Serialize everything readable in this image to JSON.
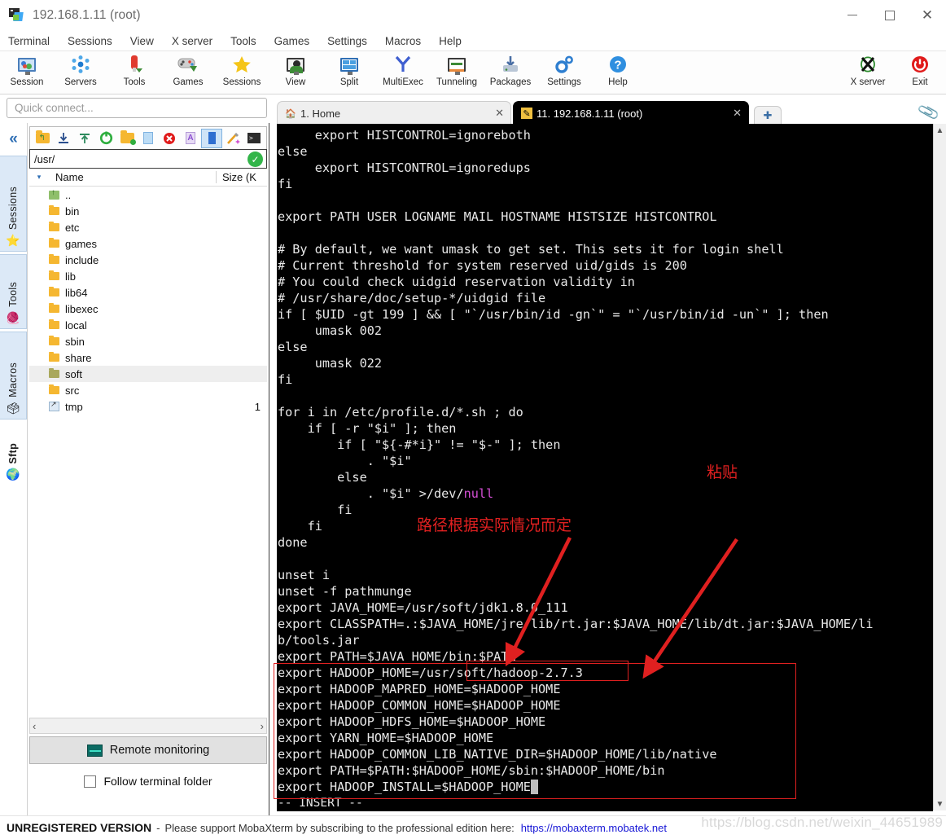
{
  "window": {
    "title": "192.168.1.11 (root)",
    "icon": "mobaxterm-icon",
    "minimize": "—",
    "maximize": "□",
    "close": "✕"
  },
  "menubar": {
    "items": [
      {
        "label": "Terminal"
      },
      {
        "label": "Sessions"
      },
      {
        "label": "View"
      },
      {
        "label": "X server"
      },
      {
        "label": "Tools"
      },
      {
        "label": "Games"
      },
      {
        "label": "Settings"
      },
      {
        "label": "Macros"
      },
      {
        "label": "Help"
      }
    ]
  },
  "toolbar": {
    "left_buttons": [
      {
        "label": "Session",
        "icon": "session-icon"
      },
      {
        "label": "Servers",
        "icon": "servers-icon"
      },
      {
        "label": "Tools",
        "icon": "tools-icon"
      },
      {
        "label": "Games",
        "icon": "games-icon"
      },
      {
        "label": "Sessions",
        "icon": "sessions-star-icon"
      },
      {
        "label": "View",
        "icon": "view-icon"
      },
      {
        "label": "Split",
        "icon": "split-icon"
      },
      {
        "label": "MultiExec",
        "icon": "multiexec-icon"
      },
      {
        "label": "Tunneling",
        "icon": "tunneling-icon"
      },
      {
        "label": "Packages",
        "icon": "packages-icon"
      },
      {
        "label": "Settings",
        "icon": "settings-gear-icon"
      },
      {
        "label": "Help",
        "icon": "help-icon"
      }
    ],
    "right_buttons": [
      {
        "label": "X server",
        "icon": "x-server-icon"
      },
      {
        "label": "Exit",
        "icon": "exit-power-icon"
      }
    ]
  },
  "quick_connect": {
    "placeholder": "Quick connect...",
    "value": ""
  },
  "rail": {
    "collapse": "«",
    "tabs": [
      {
        "label": "Sessions",
        "icon": "star-icon"
      },
      {
        "label": "Tools",
        "icon": "swiss-knife-icon"
      },
      {
        "label": "Macros",
        "icon": "paper-plane-icon"
      },
      {
        "label": "Sftp",
        "icon": "globe-icon"
      }
    ]
  },
  "sftp": {
    "toolbar_icons": [
      "parent-folder-icon",
      "download-icon",
      "upload-icon",
      "refresh-icon",
      "new-folder-icon",
      "new-file-icon",
      "delete-icon",
      "text-mode-icon",
      "binary-mode-icon",
      "magic-wand-icon",
      "terminal-icon"
    ],
    "selected_toolbar_icon": "binary-mode-icon",
    "path": "/usr/",
    "path_ok_icon": "check-icon",
    "columns": [
      "Name",
      "Size (K"
    ],
    "sort_caret": "▾",
    "rows": [
      {
        "name": "..",
        "size": "",
        "icon": "up-folder-icon",
        "selected": false
      },
      {
        "name": "bin",
        "size": "",
        "icon": "folder-icon",
        "selected": false
      },
      {
        "name": "etc",
        "size": "",
        "icon": "folder-icon",
        "selected": false
      },
      {
        "name": "games",
        "size": "",
        "icon": "folder-icon",
        "selected": false
      },
      {
        "name": "include",
        "size": "",
        "icon": "folder-icon",
        "selected": false
      },
      {
        "name": "lib",
        "size": "",
        "icon": "folder-icon",
        "selected": false
      },
      {
        "name": "lib64",
        "size": "",
        "icon": "folder-icon",
        "selected": false
      },
      {
        "name": "libexec",
        "size": "",
        "icon": "folder-icon",
        "selected": false
      },
      {
        "name": "local",
        "size": "",
        "icon": "folder-icon",
        "selected": false
      },
      {
        "name": "sbin",
        "size": "",
        "icon": "folder-icon",
        "selected": false
      },
      {
        "name": "share",
        "size": "",
        "icon": "folder-icon",
        "selected": false
      },
      {
        "name": "soft",
        "size": "",
        "icon": "folder-icon-olive",
        "selected": true
      },
      {
        "name": "src",
        "size": "",
        "icon": "folder-icon",
        "selected": false
      },
      {
        "name": "tmp",
        "size": "1",
        "icon": "symlink-icon",
        "selected": false
      }
    ],
    "hscroll_left": "‹",
    "hscroll_right": "›",
    "remote_monitoring": "Remote monitoring",
    "remote_monitoring_icon": "monitor-graph-icon",
    "follow_terminal_folder": "Follow terminal folder",
    "follow_checked": false
  },
  "tabs": {
    "items": [
      {
        "label": "1. Home",
        "icon": "home-icon",
        "close": "✕",
        "active": false
      },
      {
        "label": "11. 192.168.1.11 (root)",
        "icon": "ssh-icon",
        "close": "✕",
        "active": true
      }
    ],
    "add_label": "✚",
    "clip_icon": "paperclip-icon"
  },
  "terminal": {
    "lines": [
      "     export HISTCONTROL=ignoreboth",
      "else",
      "     export HISTCONTROL=ignoredups",
      "fi",
      "",
      "export PATH USER LOGNAME MAIL HOSTNAME HISTSIZE HISTCONTROL",
      "",
      "# By default, we want umask to get set. This sets it for login shell",
      "# Current threshold for system reserved uid/gids is 200",
      "# You could check uidgid reservation validity in",
      "# /usr/share/doc/setup-*/uidgid file",
      "if [ $UID -gt 199 ] && [ \"`/usr/bin/id -gn`\" = \"`/usr/bin/id -un`\" ]; then",
      "     umask 002",
      "else",
      "     umask 022",
      "fi",
      "",
      "for i in /etc/profile.d/*.sh ; do",
      "    if [ -r \"$i\" ]; then",
      "        if [ \"${-#*i}\" != \"$-\" ]; then",
      "            . \"$i\"",
      "        else",
      "            . \"$i\" >/dev/null",
      "        fi",
      "    fi",
      "done",
      "",
      "unset i",
      "unset -f pathmunge",
      "export JAVA_HOME=/usr/soft/jdk1.8.0_111",
      "export CLASSPATH=.:$JAVA_HOME/jre/lib/rt.jar:$JAVA_HOME/lib/dt.jar:$JAVA_HOME/li",
      "b/tools.jar",
      "export PATH=$JAVA_HOME/bin:$PATH",
      "export HADOOP_HOME=/usr/soft/hadoop-2.7.3",
      "export HADOOP_MAPRED_HOME=$HADOOP_HOME",
      "export HADOOP_COMMON_HOME=$HADOOP_HOME",
      "export HADOOP_HDFS_HOME=$HADOOP_HOME",
      "export YARN_HOME=$HADOOP_HOME",
      "export HADOOP_COMMON_LIB_NATIVE_DIR=$HADOOP_HOME/lib/native",
      "export PATH=$PATH:$HADOOP_HOME/sbin:$HADOOP_HOME/bin",
      "export HADOOP_INSTALL=$HADOOP_HOME"
    ],
    "magenta_word": "null",
    "cursor_char": " ",
    "status_line": "-- INSERT --",
    "scroll_up_arrow": "▲",
    "scroll_down_arrow": "▼"
  },
  "annotations": {
    "paste_label": "粘贴",
    "path_note": "路径根据实际情况而定",
    "color": "#e02020"
  },
  "statusbar": {
    "unregistered": "UNREGISTERED VERSION",
    "separator": "-",
    "message": "Please support MobaXterm by subscribing to the professional edition here:",
    "link": "https://mobaxterm.mobatek.net"
  },
  "watermark": "https://blog.csdn.net/weixin_44651989"
}
